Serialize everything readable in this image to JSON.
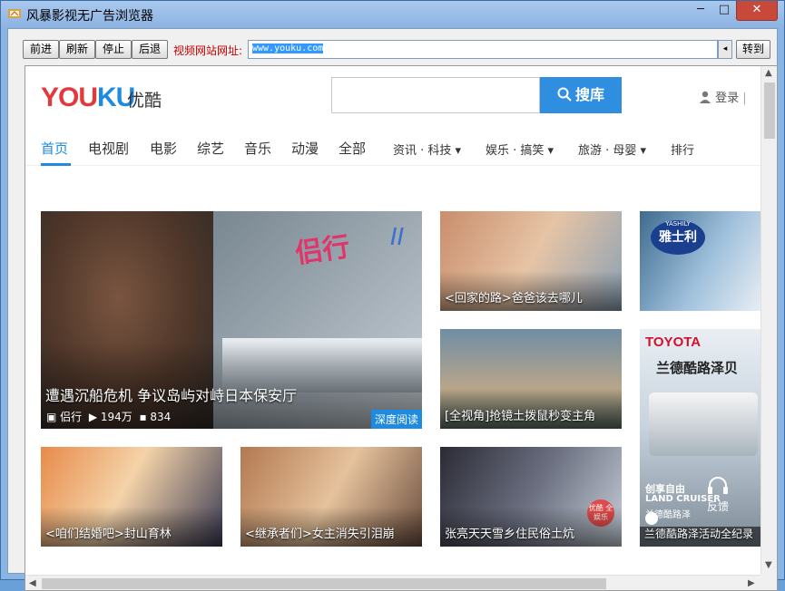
{
  "window": {
    "title": "风暴影视无广告浏览器",
    "min": "─",
    "max": "□",
    "close": "✕"
  },
  "toolbar": {
    "forward": "前进",
    "refresh": "刷新",
    "stop": "停止",
    "back": "后退",
    "address_label": "视频网站网址:",
    "address_value": "www.youku.com",
    "go": "转到"
  },
  "site": {
    "logo_youku": "YOU",
    "logo_ku": "KU",
    "logo_cn": "优酷",
    "search_placeholder": "",
    "search_button": "搜库",
    "login": "登录",
    "login_sep": "|",
    "nav": [
      "首页",
      "电视剧",
      "电影",
      "综艺",
      "音乐",
      "动漫",
      "全部"
    ],
    "nav_sub": [
      "资讯 · 科技",
      "娱乐 · 搞笑",
      "旅游 · 母婴",
      "排行"
    ]
  },
  "tiles": {
    "big": {
      "caption": "遭遇沉船危机 争议岛屿对峙日本保安厅",
      "author": "侣行",
      "views": "194万",
      "comments": "834",
      "badge": "深度阅读",
      "overlay_text": "侣行",
      "overlay_roman": "II"
    },
    "t1": "<回家的路>爸爸该去哪儿",
    "t2_logo": "雅士利",
    "t2_brand": "YASHILY",
    "t3": "[全视角]抢镜土拨鼠秒变主角",
    "t4_brand": "TOYOTA",
    "t4_title": "兰德酷路泽贝",
    "t4_caption": "兰德酷路泽活动全纪录",
    "t4_sub": "创享自由",
    "t4_land": "LAND CRUISER",
    "t4_model": "兰德酷路泽",
    "t5": "<咱们结婚吧>封山育林",
    "t6": "<继承者们>女主消失引泪崩",
    "t7": "张亮天天雪乡住民俗土炕",
    "t7_badge": "优酷 全娱乐",
    "feedback": "反馈"
  },
  "colors": {
    "accent": "#1e8be0",
    "logo_red": "#e4393c",
    "address_label": "#c00000"
  }
}
